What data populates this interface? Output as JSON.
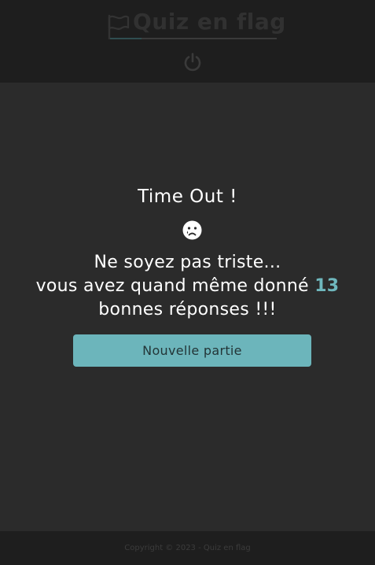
{
  "header": {
    "logo_text": "Quiz en flag",
    "logo_icon": "flag-icon",
    "power_icon": "power-icon"
  },
  "main": {
    "title": "Time Out !",
    "emoji_icon": "sad-face-icon",
    "line1": "Ne soyez pas triste...",
    "line2_prefix": "vous avez quand même donné ",
    "score": "13",
    "line3": "bonnes réponses !!!",
    "button_label": "Nouvelle partie"
  },
  "footer": {
    "copyright": "Copyright © 2023 - Quiz en flag"
  },
  "colors": {
    "header_bg": "#1e1e1e",
    "main_bg": "#2b2b2b",
    "accent": "#6cb5bb",
    "text": "#ffffff"
  }
}
